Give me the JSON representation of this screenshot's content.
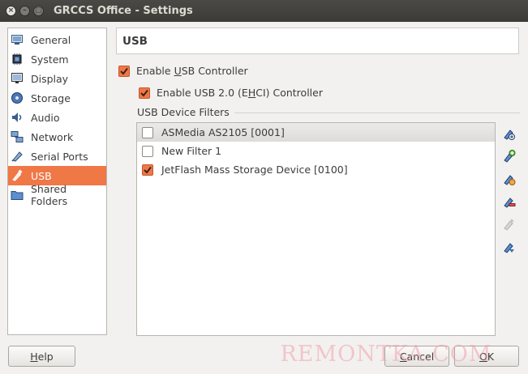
{
  "window": {
    "title": "GRCCS Office - Settings",
    "close_glyph": "×",
    "min_glyph": "–",
    "max_glyph": "□"
  },
  "sidebar": {
    "items": [
      {
        "label": "General",
        "icon": "general-icon",
        "active": false
      },
      {
        "label": "System",
        "icon": "chip-icon",
        "active": false
      },
      {
        "label": "Display",
        "icon": "monitor-icon",
        "active": false
      },
      {
        "label": "Storage",
        "icon": "disk-icon",
        "active": false
      },
      {
        "label": "Audio",
        "icon": "speaker-icon",
        "active": false
      },
      {
        "label": "Network",
        "icon": "network-icon",
        "active": false
      },
      {
        "label": "Serial Ports",
        "icon": "serial-icon",
        "active": false
      },
      {
        "label": "USB",
        "icon": "usb-icon",
        "active": true
      },
      {
        "label": "Shared Folders",
        "icon": "folder-icon",
        "active": false
      }
    ]
  },
  "page": {
    "header": "USB",
    "enable_usb": {
      "pre": "Enable ",
      "u": "U",
      "post": "SB Controller",
      "checked": true
    },
    "enable_ehci": {
      "pre": "Enable USB 2.0 (E",
      "u": "H",
      "post": "CI) Controller",
      "checked": true
    },
    "filters_title": "USB Device Filters",
    "filters": [
      {
        "label": "ASMedia AS2105 [0001]",
        "checked": false,
        "selected": true
      },
      {
        "label": "New Filter 1",
        "checked": false,
        "selected": false
      },
      {
        "label": "JetFlash Mass Storage Device [0100]",
        "checked": true,
        "selected": false
      }
    ],
    "tools": [
      {
        "icon": "add-filter-icon",
        "enabled": true
      },
      {
        "icon": "add-from-device-icon",
        "enabled": true
      },
      {
        "icon": "edit-filter-icon",
        "enabled": true
      },
      {
        "icon": "remove-filter-icon",
        "enabled": true
      },
      {
        "icon": "move-up-icon",
        "enabled": false
      },
      {
        "icon": "move-down-icon",
        "enabled": true
      }
    ]
  },
  "buttons": {
    "help": {
      "u": "H",
      "rest": "elp"
    },
    "cancel": {
      "u": "C",
      "rest": "ancel"
    },
    "ok": {
      "u": "O",
      "rest": "K"
    }
  },
  "watermark": "REMONTKA.COM",
  "colors": {
    "accent": "#f07746",
    "titlebar": "#3c3b37"
  }
}
